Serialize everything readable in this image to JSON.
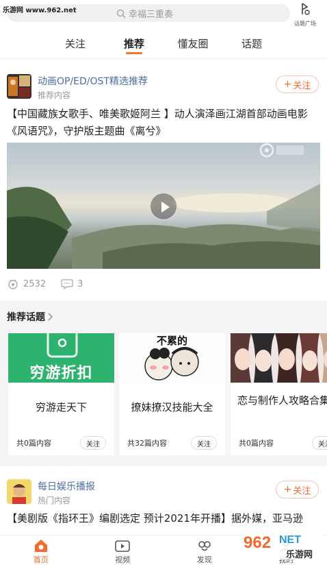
{
  "watermark_top": "乐游网 www.962.net",
  "search": {
    "placeholder": "幸福三重奏"
  },
  "topic_square": {
    "label": "话题广场"
  },
  "tabs": [
    {
      "label": "关注"
    },
    {
      "label": "推荐"
    },
    {
      "label": "懂友圈"
    },
    {
      "label": "话题"
    }
  ],
  "post1": {
    "title": "动画OP/ED/OST精选推荐",
    "subtitle": "推荐内容",
    "follow_label": "关注",
    "text": "【中国藏族女歌手、唯美歌姬阿兰 】动人演泽画江湖首部动画电影《风语咒》，守护版主题曲《离兮》",
    "views": "2532",
    "comments": "3"
  },
  "recommended_topics": {
    "title": "推荐话题",
    "cards": [
      {
        "image_text": "穷游折扣",
        "name": "穷游走天下",
        "count": "共0篇内容",
        "follow_label": "关注"
      },
      {
        "image_text": "不累的",
        "name": "撩妹撩汉技能大全",
        "count": "共32篇内容",
        "follow_label": "关注"
      },
      {
        "name": "恋与制作人攻略合集",
        "count": "共0篇内容",
        "follow_label": "关注"
      }
    ]
  },
  "post2": {
    "title": "每日娱乐播报",
    "subtitle": "热门内容",
    "follow_label": "关注",
    "text": "【美剧版《指环王》编剧选定 预计2021年开播】据外媒，亚马逊"
  },
  "bottom_nav": [
    {
      "label": "首页",
      "icon": "home-icon",
      "active": true
    },
    {
      "label": "视频",
      "icon": "video-icon"
    },
    {
      "label": "发现",
      "icon": "discover-icon"
    },
    {
      "label": "我的",
      "icon": "profile-icon"
    }
  ],
  "watermark_bottom": {
    "brand": "962",
    "suffix": "NET",
    "cn": "乐游网"
  },
  "colors": {
    "accent": "#f26a2e",
    "link_blue": "#4b6ea3",
    "green": "#2db36e"
  }
}
